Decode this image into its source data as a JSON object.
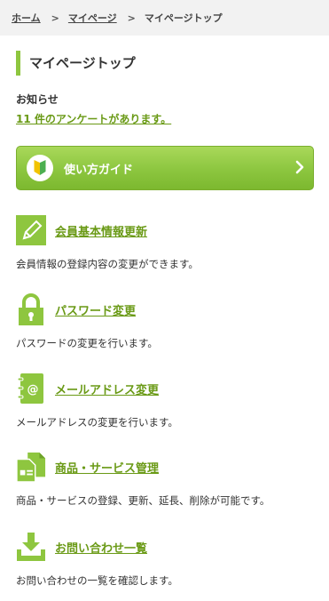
{
  "breadcrumb": {
    "home": "ホーム",
    "separator": ">",
    "mypage": "マイページ",
    "current": "マイページトップ"
  },
  "page_title": "マイページトップ",
  "notice": {
    "label": "お知らせ",
    "link": "11 件のアンケートがあります。"
  },
  "guide_button": {
    "label": "使い方ガイド",
    "icon": "beginner-leaf-icon",
    "chevron": "chevron-right-icon"
  },
  "menu": [
    {
      "icon": "pencil-edit-icon",
      "title": "会員基本情報更新",
      "desc": "会員情報の登録内容の変更ができます。"
    },
    {
      "icon": "padlock-icon",
      "title": "パスワード変更",
      "desc": "パスワードの変更を行います。"
    },
    {
      "icon": "email-notebook-icon",
      "title": "メールアドレス変更",
      "desc": "メールアドレスの変更を行います。"
    },
    {
      "icon": "documents-icon",
      "title": "商品・サービス管理",
      "desc": "商品・サービスの登録、更新、延長、削除が可能です。"
    },
    {
      "icon": "download-tray-icon",
      "title": "お問い合わせ一覧",
      "desc": "お問い合わせの一覧を確認します。"
    }
  ],
  "colors": {
    "accent": "#8ec63f",
    "link": "#6a9a16",
    "breadcrumb_bg": "#f2f2f2"
  }
}
